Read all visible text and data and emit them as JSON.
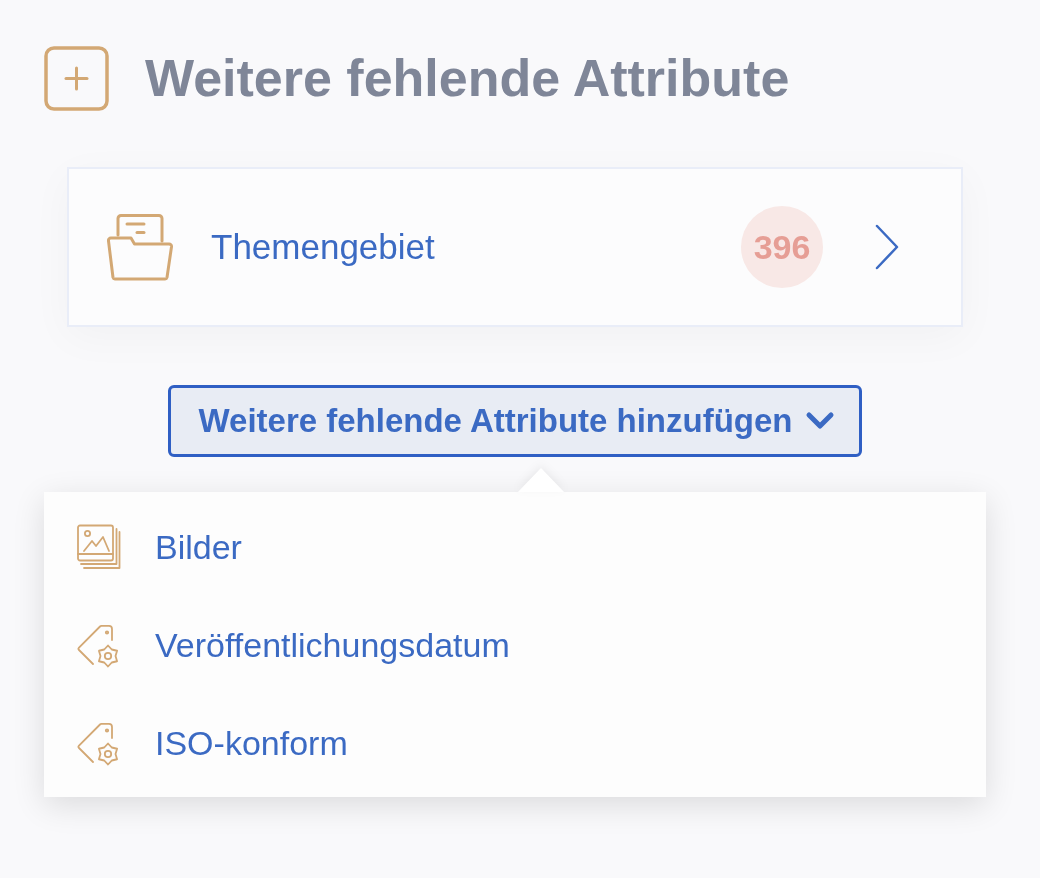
{
  "header": {
    "title": "Weitere fehlende Attribute"
  },
  "attributes": [
    {
      "label": "Themengebiet",
      "count": "396"
    }
  ],
  "add_button": {
    "label": "Weitere fehlende Attribute hinzufügen",
    "expanded": true
  },
  "menu": {
    "items": [
      {
        "kind": "images",
        "label": "Bilder"
      },
      {
        "kind": "attribute",
        "label": "Veröffentlichungsdatum"
      },
      {
        "kind": "attribute",
        "label": "ISO-konform"
      }
    ]
  }
}
